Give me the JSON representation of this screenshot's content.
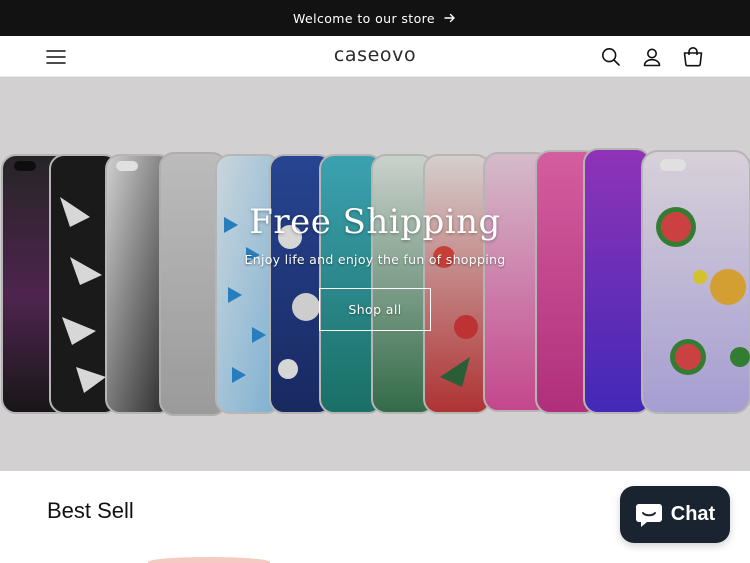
{
  "announcement": {
    "text": "Welcome to our store"
  },
  "header": {
    "logo": "caseovo"
  },
  "hero": {
    "title": "Free Shipping",
    "subtitle": "Enjoy life and enjoy the fun of shopping",
    "button": "Shop all"
  },
  "section": {
    "title": "Best Sell"
  },
  "chat": {
    "label": "Chat"
  },
  "icons": {
    "menu": "hamburger-menu-icon",
    "search": "search-icon",
    "account": "user-icon",
    "cart": "cart-icon",
    "arrow": "arrow-right-icon",
    "chat": "chat-bubble-icon"
  }
}
